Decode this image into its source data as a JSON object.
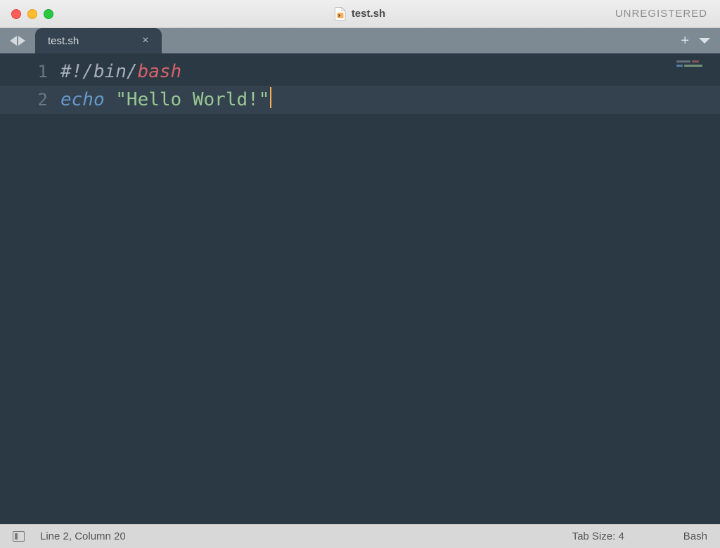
{
  "window": {
    "title": "test.sh",
    "license_state": "UNREGISTERED"
  },
  "tabs": [
    {
      "label": "test.sh",
      "active": true
    }
  ],
  "editor": {
    "active_line_index": 1,
    "lines": [
      {
        "n": "1",
        "tokens": [
          {
            "cls": "tok-comment",
            "text": "#!/bin/"
          },
          {
            "cls": "tok-red",
            "text": "bash"
          }
        ]
      },
      {
        "n": "2",
        "tokens": [
          {
            "cls": "tok-blue",
            "text": "echo"
          },
          {
            "cls": "",
            "text": " "
          },
          {
            "cls": "tok-green",
            "text": "\"Hello World!\""
          }
        ]
      }
    ]
  },
  "statusbar": {
    "position": "Line 2, Column 20",
    "tab_size": "Tab Size: 4",
    "syntax": "Bash"
  }
}
